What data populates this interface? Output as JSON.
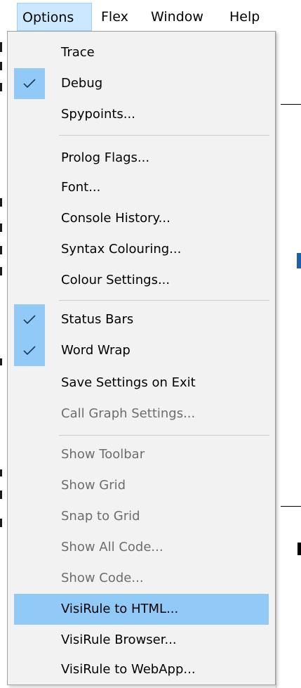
{
  "menubar": {
    "items": [
      {
        "label": "Options"
      },
      {
        "label": "Flex"
      },
      {
        "label": "Window"
      },
      {
        "label": "Help"
      }
    ]
  },
  "options_menu": {
    "items": [
      {
        "label": "Trace",
        "checked": false,
        "enabled": true
      },
      {
        "label": "Debug",
        "checked": true,
        "enabled": true
      },
      {
        "label": "Spypoints...",
        "checked": false,
        "enabled": true
      },
      {
        "label": "Prolog Flags...",
        "checked": false,
        "enabled": true
      },
      {
        "label": "Font...",
        "checked": false,
        "enabled": true
      },
      {
        "label": "Console History...",
        "checked": false,
        "enabled": true
      },
      {
        "label": "Syntax Colouring...",
        "checked": false,
        "enabled": true
      },
      {
        "label": "Colour Settings...",
        "checked": false,
        "enabled": true
      },
      {
        "label": "Status Bars",
        "checked": true,
        "enabled": true
      },
      {
        "label": "Word Wrap",
        "checked": true,
        "enabled": true
      },
      {
        "label": "Save Settings on Exit",
        "checked": false,
        "enabled": true
      },
      {
        "label": "Call Graph Settings...",
        "checked": false,
        "enabled": false
      },
      {
        "label": "Show Toolbar",
        "checked": false,
        "enabled": false
      },
      {
        "label": "Show Grid",
        "checked": false,
        "enabled": false
      },
      {
        "label": "Snap to Grid",
        "checked": false,
        "enabled": false
      },
      {
        "label": "Show All Code...",
        "checked": false,
        "enabled": false
      },
      {
        "label": "Show Code...",
        "checked": false,
        "enabled": false
      },
      {
        "label": "VisiRule to HTML...",
        "checked": false,
        "enabled": true,
        "highlighted": true
      },
      {
        "label": "VisiRule Browser...",
        "checked": false,
        "enabled": true
      },
      {
        "label": "VisiRule to WebApp...",
        "checked": false,
        "enabled": true
      }
    ]
  },
  "colors": {
    "menubar_active_bg": "#cce8ff",
    "menu_bg": "#f2f2f2",
    "highlight_bg": "#91c9f7",
    "check_bg": "#91c9f7",
    "disabled_text": "#6d6d6d"
  }
}
